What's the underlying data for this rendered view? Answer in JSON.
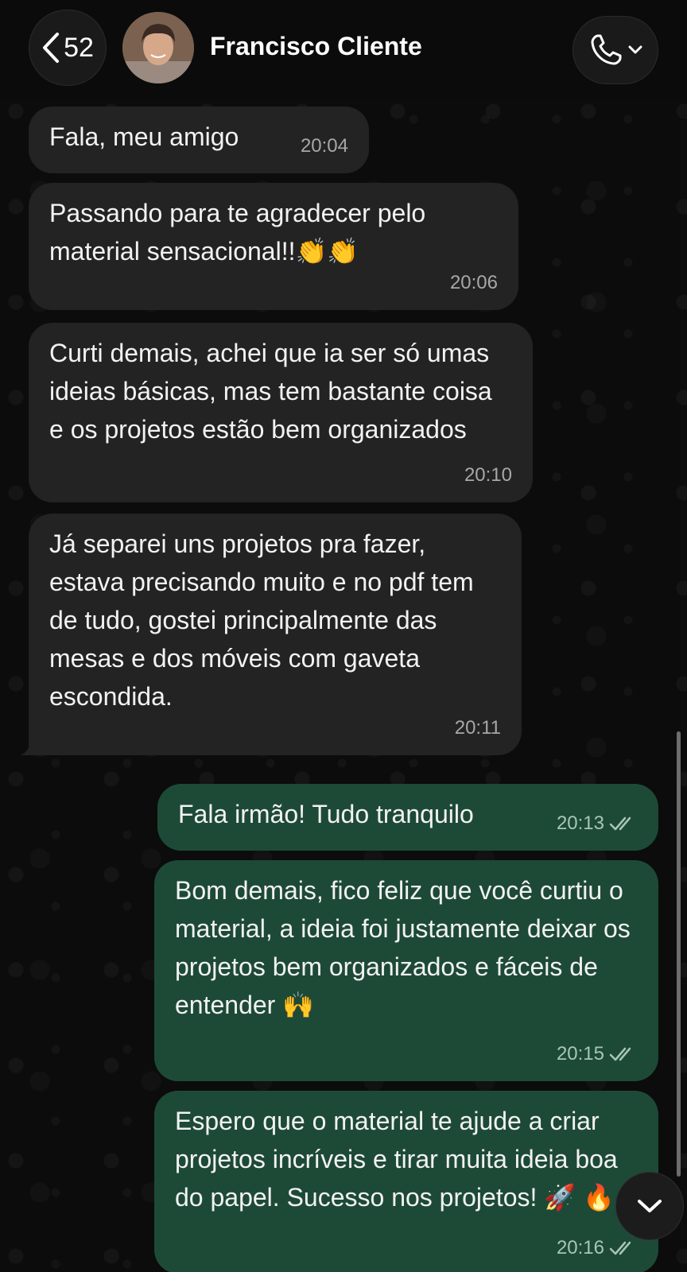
{
  "header": {
    "back_count": "52",
    "contact_name": "Francisco Cliente"
  },
  "messages": [
    {
      "direction": "in",
      "text": "Fala, meu amigo",
      "time": "20:04"
    },
    {
      "direction": "in",
      "text": "Passando para te agradecer pelo material sensacional!!👏👏",
      "time": "20:06"
    },
    {
      "direction": "in",
      "text": "Curti demais, achei que ia ser só umas ideias básicas, mas tem bastante coisa e os projetos estão bem organizados",
      "time": "20:10"
    },
    {
      "direction": "in",
      "text": "Já separei uns projetos pra fazer, estava precisando muito e no pdf tem de tudo, gostei principalmente das mesas e dos móveis com gaveta escondida.",
      "time": "20:11"
    },
    {
      "direction": "out",
      "text": "Fala irmão! Tudo tranquilo",
      "time": "20:13",
      "status": "read"
    },
    {
      "direction": "out",
      "text": "Bom demais, fico feliz que você curtiu o material, a ideia foi justamente deixar os projetos bem organizados e fáceis de entender 🙌",
      "time": "20:15",
      "status": "read"
    },
    {
      "direction": "out",
      "text": "Espero que o material te ajude a criar projetos incríveis e tirar muita ideia boa do papel. Sucesso nos projetos! 🚀 🔥",
      "time": "20:16",
      "status": "read"
    }
  ],
  "colors": {
    "incoming_bubble": "#232323",
    "outgoing_bubble": "#1d4a36",
    "background": "#0c0c0c"
  },
  "icons": {
    "back": "chevron-left-icon",
    "call": "phone-icon",
    "call_menu": "chevron-down-icon",
    "read_receipt": "double-check-icon",
    "scroll_down": "chevron-down-icon"
  }
}
